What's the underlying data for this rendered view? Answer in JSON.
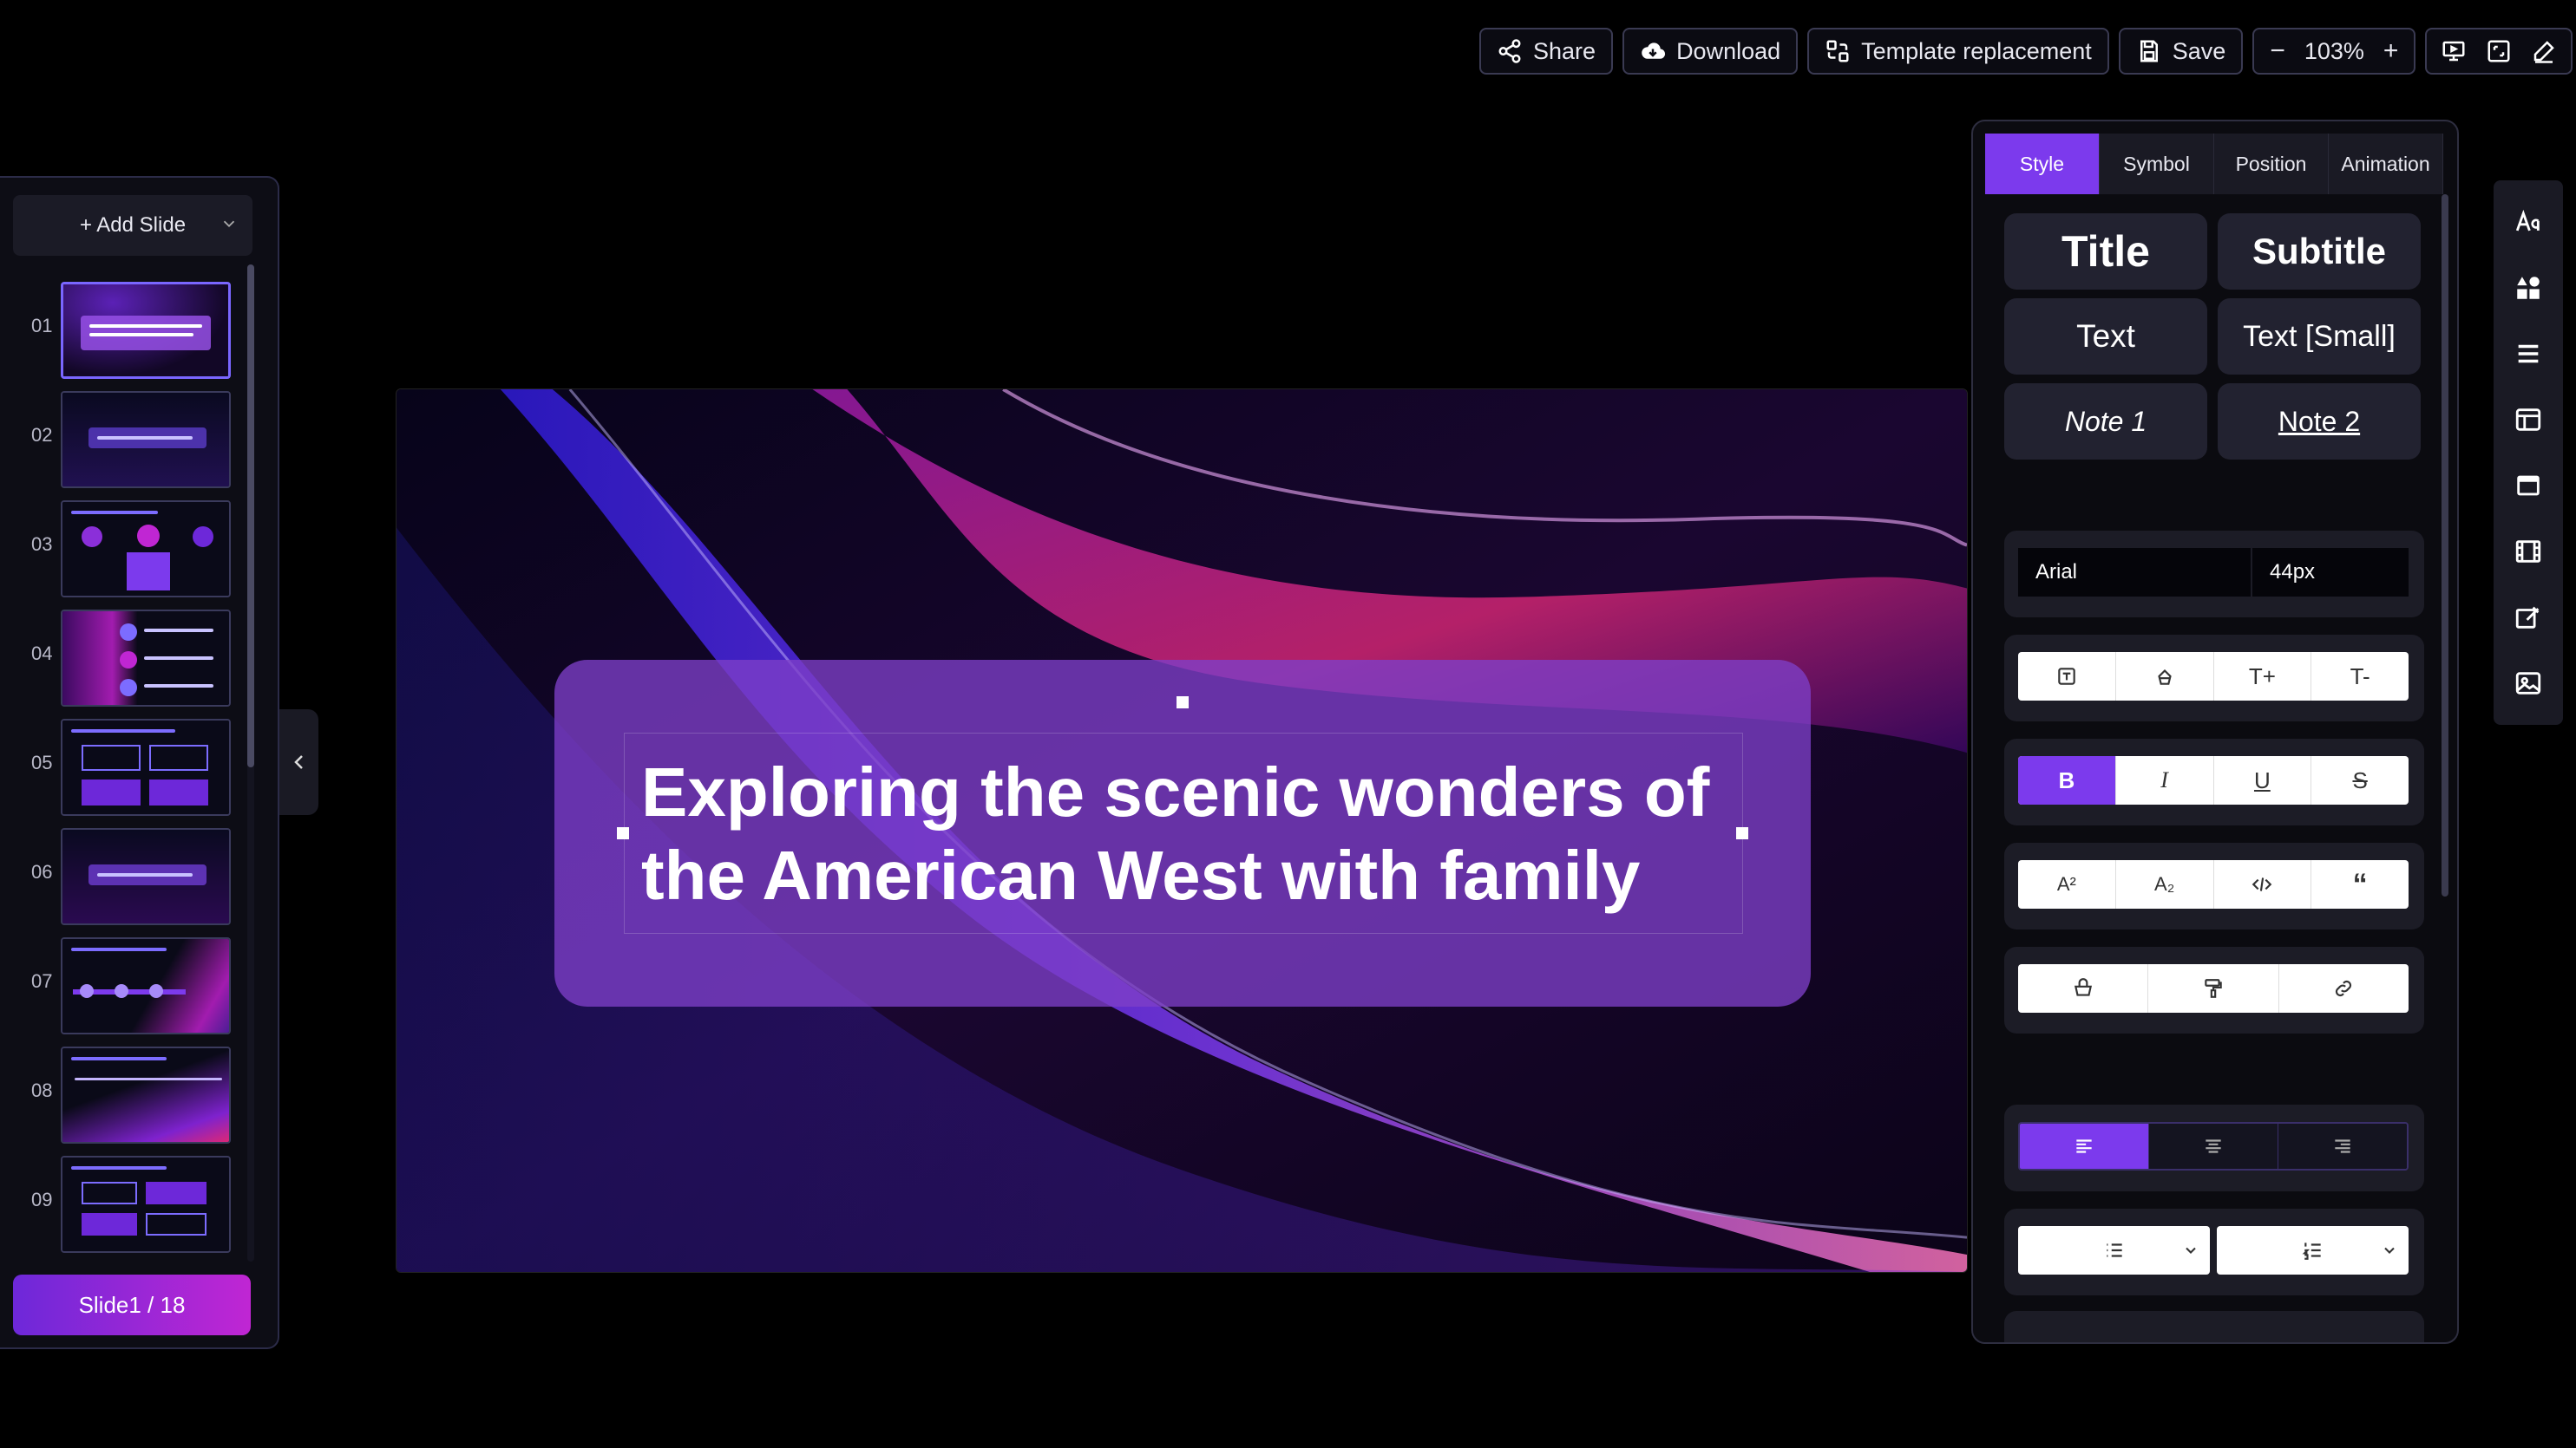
{
  "toolbar": {
    "share_label": "Share",
    "download_label": "Download",
    "template_label": "Template replacement",
    "save_label": "Save",
    "zoom_minus": "−",
    "zoom_value": "103%",
    "zoom_plus": "+"
  },
  "left_panel": {
    "add_slide_label": "+ Add Slide",
    "thumbnails": [
      {
        "number": "01"
      },
      {
        "number": "02"
      },
      {
        "number": "03"
      },
      {
        "number": "04"
      },
      {
        "number": "05"
      },
      {
        "number": "06"
      },
      {
        "number": "07"
      },
      {
        "number": "08"
      },
      {
        "number": "09"
      }
    ],
    "counter": "Slide1 / 18"
  },
  "slide": {
    "title_line1": "Exploring the scenic wonders of",
    "title_line2": "the American West with family"
  },
  "right_panel": {
    "tabs": [
      "Style",
      "Symbol",
      "Position",
      "Animation"
    ],
    "active_tab": "Style",
    "presets": {
      "title": "Title",
      "subtitle": "Subtitle",
      "text": "Text",
      "text_small": "Text [Small]",
      "note1": "Note 1",
      "note2": "Note 2"
    },
    "font_family": "Arial",
    "font_size": "44px",
    "size_buttons": {
      "increase": "T+",
      "decrease": "T-"
    },
    "format_buttons": {
      "bold": "B",
      "italic": "I",
      "underline": "U",
      "strike": "S"
    },
    "script_buttons": {
      "superscript": "A²",
      "subscript": "A₂",
      "quote": "“"
    }
  },
  "colors": {
    "accent": "#7c3aed",
    "panel_bg": "#1c1c26",
    "counter_gradient_start": "#6d28d9",
    "counter_gradient_end": "#c026d3"
  }
}
